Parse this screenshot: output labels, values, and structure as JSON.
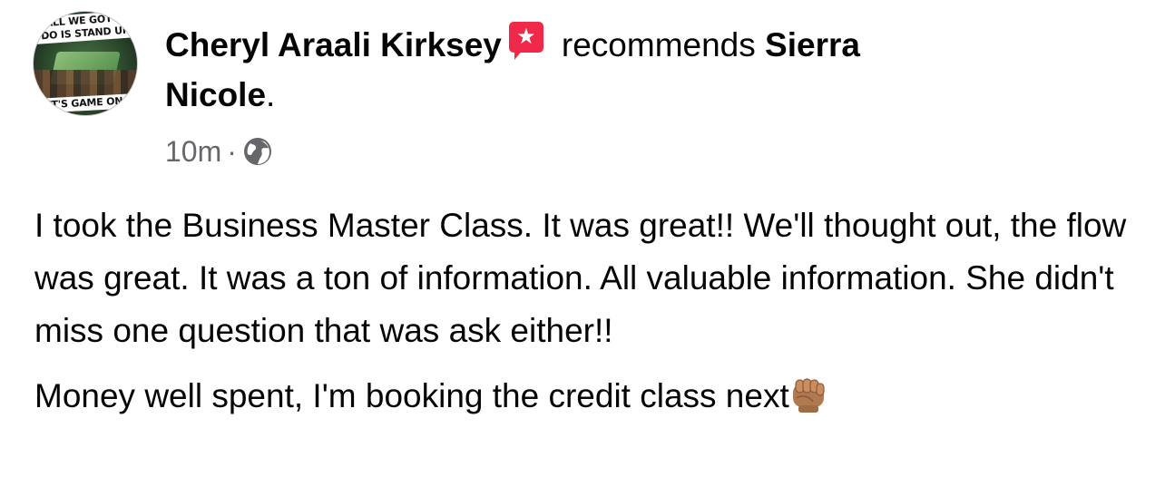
{
  "post": {
    "avatar": {
      "banner_top": "ALL WE GOTTA",
      "banner_mid": "DO IS STAND UP",
      "banner_bottom": "IT'S GAME ON"
    },
    "author": "Cheryl Araali Kirksey",
    "badge_icon": "recommendation-star-icon",
    "action": "recommends",
    "recommended_page": "Sierra Nicole",
    "period": ".",
    "timestamp": "10m",
    "separator": "·",
    "privacy_icon": "globe-icon",
    "paragraphs": [
      "I took the Business Master Class. It was great!! We'll thought out, the flow was great. It was a ton of information. All valuable information. She didn't miss one question that was ask either!!",
      "Money well spent, I'm booking the credit class next"
    ],
    "trailing_emoji": "fist-bump-emoji"
  },
  "colors": {
    "text": "#050505",
    "secondary_text": "#65676b",
    "badge": "#f0284a",
    "background": "#ffffff"
  }
}
